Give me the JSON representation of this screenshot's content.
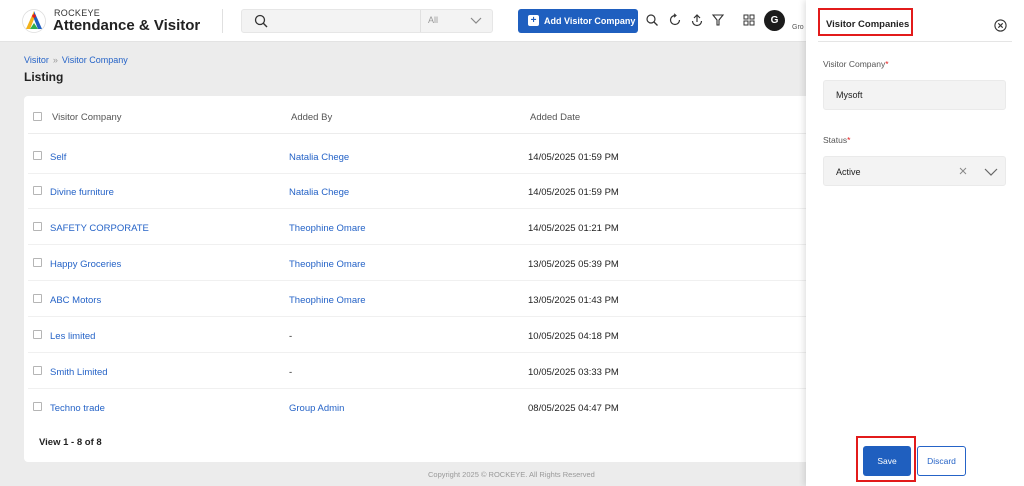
{
  "app": {
    "brand_small": "ROCKEYE",
    "brand_title": "Attendance & Visitor"
  },
  "header": {
    "search_placeholder": "",
    "search_scope": "All",
    "add_button_label": "Add Visitor Company",
    "user_initial": "G",
    "user_name": "Gro",
    "icons": [
      "search-icon",
      "refresh-icon",
      "upload-icon",
      "filter-icon",
      "grid-icon"
    ]
  },
  "breadcrumb": [
    "Visitor",
    "Visitor Company"
  ],
  "page_title": "Listing",
  "table": {
    "columns": [
      "Visitor Company",
      "Added By",
      "Added Date"
    ],
    "rows": [
      {
        "company": "Self",
        "added_by": "Natalia Chege",
        "date": "14/05/2025 01:59 PM"
      },
      {
        "company": "Divine furniture",
        "added_by": "Natalia Chege",
        "date": "14/05/2025 01:59 PM"
      },
      {
        "company": "SAFETY CORPORATE",
        "added_by": "Theophine Omare",
        "date": "14/05/2025 01:21 PM"
      },
      {
        "company": "Happy Groceries",
        "added_by": "Theophine Omare",
        "date": "13/05/2025 05:39 PM"
      },
      {
        "company": "ABC Motors",
        "added_by": "Theophine Omare",
        "date": "13/05/2025 01:43 PM"
      },
      {
        "company": "Les limited",
        "added_by": "-",
        "date": "10/05/2025 04:18 PM"
      },
      {
        "company": "Smith Limited",
        "added_by": "-",
        "date": "10/05/2025 03:33 PM"
      },
      {
        "company": "Techno trade",
        "added_by": "Group Admin",
        "date": "08/05/2025 04:47 PM"
      }
    ],
    "footer": "View 1 - 8 of 8"
  },
  "copyright": "Copyright 2025 © ROCKEYE. All Rights Reserved",
  "drawer": {
    "title": "Visitor Companies",
    "company_label": "Visitor Company",
    "company_value": "Mysoft",
    "status_label": "Status",
    "status_value": "Active",
    "required_mark": "*",
    "save_label": "Save",
    "discard_label": "Discard"
  },
  "colors": {
    "primary": "#1f5fbf",
    "link": "#2563c7",
    "highlight": "#e21b1b"
  }
}
